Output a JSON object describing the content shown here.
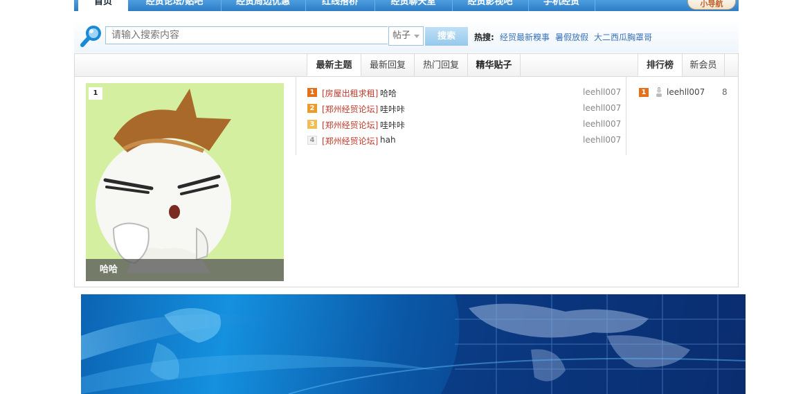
{
  "nav": {
    "items": [
      {
        "label": "首页"
      },
      {
        "label": "经贸论坛/贴吧"
      },
      {
        "label": "经贸周边优惠"
      },
      {
        "label": "红线搭桥"
      },
      {
        "label": "经贸聊天室"
      },
      {
        "label": "经贸影视吧"
      },
      {
        "label": "手机经贸"
      }
    ],
    "right_button": "小导航"
  },
  "search": {
    "placeholder": "请输入搜索内容",
    "type_selected": "帖子",
    "button": "搜索",
    "hot_label": "热搜:",
    "hot_links": [
      "经贸最新糗事",
      "暑假放假",
      "大二西瓜胸罩哥"
    ]
  },
  "tabs": {
    "topics": [
      {
        "label": "最新主题"
      },
      {
        "label": "最新回复"
      },
      {
        "label": "热门回复"
      },
      {
        "label": "精华贴子"
      }
    ],
    "ranking": [
      {
        "label": "排行榜"
      },
      {
        "label": "新会员"
      }
    ]
  },
  "feature": {
    "number": "1",
    "caption": "哈哈"
  },
  "topics": [
    {
      "rank": "1",
      "category": "[房屋出租求租]",
      "title": "哈哈",
      "author": "leehll007"
    },
    {
      "rank": "2",
      "category": "[郑州经贸论坛]",
      "title": "哇咔咔",
      "author": "leehll007"
    },
    {
      "rank": "3",
      "category": "[郑州经贸论坛]",
      "title": "哇咔咔",
      "author": "leehll007"
    },
    {
      "rank": "4",
      "category": "[郑州经贸论坛]",
      "title": "hah",
      "author": "leehll007"
    }
  ],
  "ranking": [
    {
      "rank": "1",
      "name": "leehll007",
      "count": "8"
    }
  ],
  "colors": {
    "nav_bg": "#2d7cc6",
    "category_red": "#c0392b",
    "link_blue": "#3a73b8",
    "rank1": "#e5701a",
    "rank2": "#ee9a2b",
    "rank3": "#f0be55"
  }
}
